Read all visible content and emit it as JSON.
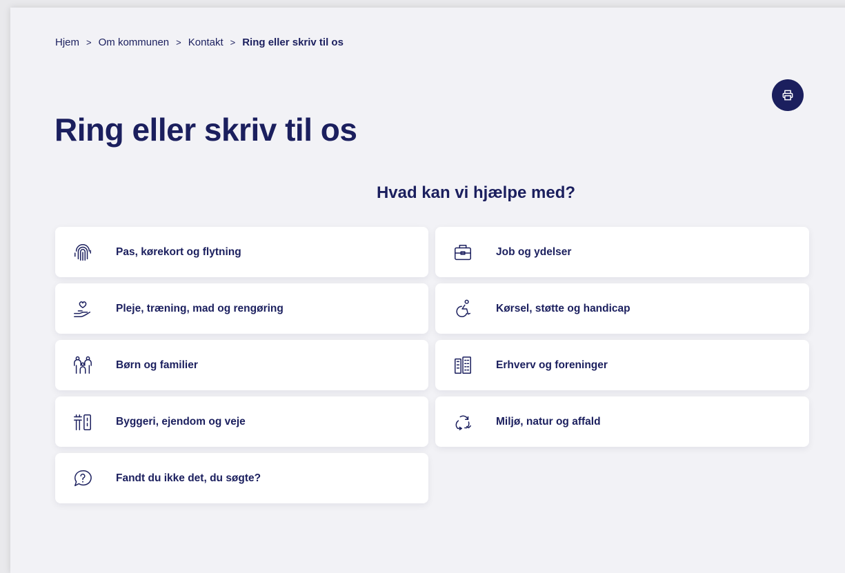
{
  "breadcrumb": {
    "items": [
      "Hjem",
      "Om kommunen",
      "Kontakt"
    ],
    "separator": ">",
    "current": "Ring eller skriv til os"
  },
  "print_button": {
    "icon": "printer-icon"
  },
  "page_title": "Ring eller skriv til os",
  "section_title": "Hvad kan vi hjælpe med?",
  "categories": [
    {
      "label": "Pas, kørekort og flytning",
      "icon": "fingerprint-icon"
    },
    {
      "label": "Job og ydelser",
      "icon": "briefcase-icon"
    },
    {
      "label": "Pleje, træning, mad og rengøring",
      "icon": "heart-hand-icon"
    },
    {
      "label": "Kørsel, støtte og handicap",
      "icon": "wheelchair-icon"
    },
    {
      "label": "Børn og familier",
      "icon": "family-icon"
    },
    {
      "label": "Erhverv og foreninger",
      "icon": "buildings-icon"
    },
    {
      "label": "Byggeri, ejendom og veje",
      "icon": "construction-icon"
    },
    {
      "label": "Miljø, natur og affald",
      "icon": "recycle-icon"
    },
    {
      "label": "Fandt du ikke det, du søgte?",
      "icon": "question-bubble-icon"
    }
  ],
  "colors": {
    "primary": "#1b1f5e",
    "background": "#f2f2f6",
    "card": "#ffffff"
  }
}
